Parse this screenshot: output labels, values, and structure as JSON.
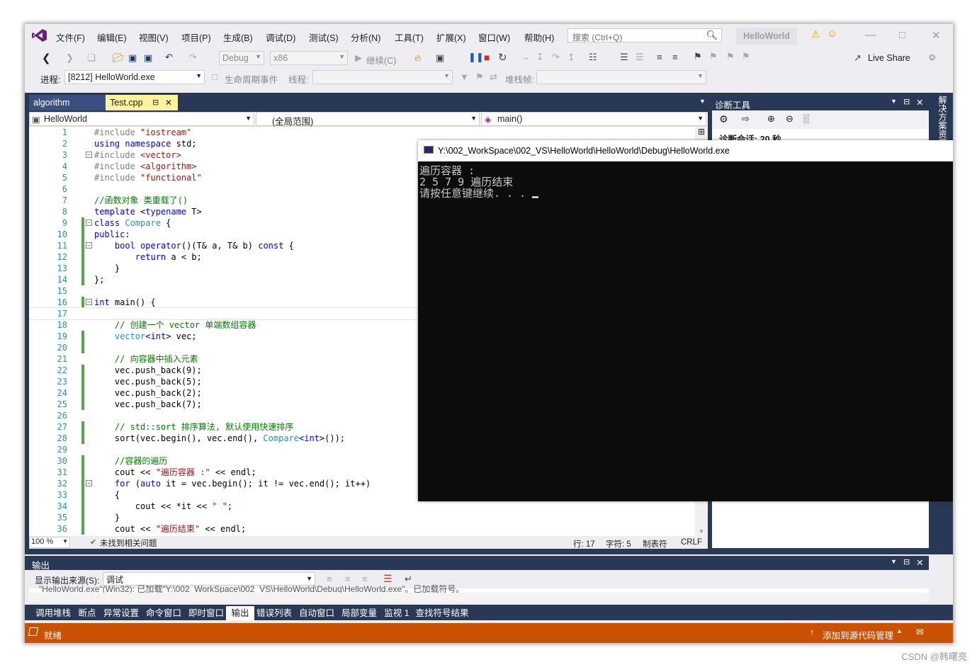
{
  "menu": {
    "items": [
      "文件(F)",
      "编辑(E)",
      "视图(V)",
      "项目(P)",
      "生成(B)",
      "调试(D)",
      "测试(S)",
      "分析(N)",
      "工具(T)",
      "扩展(X)",
      "窗口(W)",
      "帮助(H)"
    ],
    "search_placeholder": "搜索 (Ctrl+Q)",
    "solution_badge": "HelloWorld"
  },
  "toolbar": {
    "config": "Debug",
    "platform": "x86",
    "continue_label": "继续(C)",
    "live_share": "Live Share",
    "process_label": "进程:",
    "process_value": "[8212] HelloWorld.exe",
    "lifecycle_label": "生命周期事件",
    "thread_label": "线程:",
    "stackframe_label": "堆栈帧:"
  },
  "tabs": {
    "inactive": "algorithm",
    "active": "Test.cpp"
  },
  "navbar": {
    "project": "HelloWorld",
    "scope": "(全局范围)",
    "member": "main()"
  },
  "code_lines": [
    {
      "n": "1",
      "t": "#include \"iostream\""
    },
    {
      "n": "2",
      "t": "using namespace std;"
    },
    {
      "n": "3",
      "t": "#include <vector>"
    },
    {
      "n": "4",
      "t": "#include <algorithm>"
    },
    {
      "n": "5",
      "t": "#include \"functional\""
    },
    {
      "n": "6",
      "t": ""
    },
    {
      "n": "7",
      "t": "//函数对象 类重载了()"
    },
    {
      "n": "8",
      "t": "template <typename T>"
    },
    {
      "n": "9",
      "t": "class Compare {"
    },
    {
      "n": "10",
      "t": "public:"
    },
    {
      "n": "11",
      "t": "    bool operator()(T& a, T& b) const {"
    },
    {
      "n": "12",
      "t": "        return a < b;"
    },
    {
      "n": "13",
      "t": "    }"
    },
    {
      "n": "14",
      "t": "};"
    },
    {
      "n": "15",
      "t": ""
    },
    {
      "n": "16",
      "t": "int main() {"
    },
    {
      "n": "17",
      "t": ""
    },
    {
      "n": "18",
      "t": "    // 创建一个 vector 单端数组容器"
    },
    {
      "n": "19",
      "t": "    vector<int> vec;"
    },
    {
      "n": "20",
      "t": ""
    },
    {
      "n": "21",
      "t": "    // 向容器中插入元素"
    },
    {
      "n": "22",
      "t": "    vec.push_back(9);"
    },
    {
      "n": "23",
      "t": "    vec.push_back(5);"
    },
    {
      "n": "24",
      "t": "    vec.push_back(2);"
    },
    {
      "n": "25",
      "t": "    vec.push_back(7);"
    },
    {
      "n": "26",
      "t": ""
    },
    {
      "n": "27",
      "t": "    // std::sort 排序算法, 默认使用快速排序"
    },
    {
      "n": "28",
      "t": "    sort(vec.begin(), vec.end(), Compare<int>());"
    },
    {
      "n": "29",
      "t": ""
    },
    {
      "n": "30",
      "t": "    //容器的遍历"
    },
    {
      "n": "31",
      "t": "    cout << \"遍历容器 :\" << endl;"
    },
    {
      "n": "32",
      "t": "    for (auto it = vec.begin(); it != vec.end(); it++)"
    },
    {
      "n": "33",
      "t": "    {"
    },
    {
      "n": "34",
      "t": "        cout << *it << \" \";"
    },
    {
      "n": "35",
      "t": "    }"
    },
    {
      "n": "36",
      "t": "    cout << \"遍历结束\" << endl;"
    }
  ],
  "editor_status": {
    "zoom": "100 %",
    "issues": "未找到相关问题",
    "line": "行: 17",
    "char": "字符: 5",
    "tab": "制表符",
    "eol": "CRLF"
  },
  "diag": {
    "title": "诊断工具",
    "session": "诊断会话: 20 秒",
    "side_tab": "解决方案资源"
  },
  "console": {
    "title": "Y:\\002_WorkSpace\\002_VS\\HelloWorld\\HelloWorld\\Debug\\HelloWorld.exe",
    "lines": [
      "遍历容器 :",
      "2 5 7 9 遍历结束",
      "请按任意键继续. . . "
    ]
  },
  "output": {
    "title": "输出",
    "source_label": "显示输出来源(S):",
    "source_value": "调试",
    "text": "\"HelloWorld.exe\"(Win32): 已加载\"Y:\\002_WorkSpace\\002_VS\\HelloWorld\\Debug\\HelloWorld.exe\"。已加载符号。"
  },
  "bottom_tabs": [
    "调用堆栈",
    "断点",
    "异常设置",
    "命令窗口",
    "即时窗口",
    "输出",
    "错误列表",
    "自动窗口",
    "局部变量",
    "监视 1",
    "查找符号结果"
  ],
  "status": {
    "ready": "就绪",
    "source_control": "添加到源代码管理"
  },
  "watermark": "CSDN @韩曙亮",
  "colors": {
    "accent_blue": "#293955",
    "status_orange": "#ca5100",
    "change_green": "#57a64a"
  }
}
